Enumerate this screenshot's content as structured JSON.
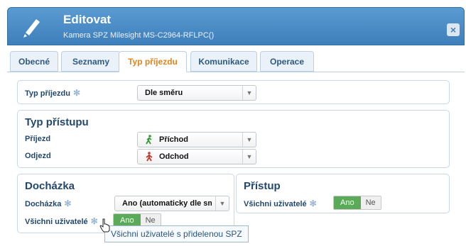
{
  "header": {
    "title": "Editovat",
    "subtitle": "Kamera SPZ Milesight MS-C2964-RFLPC()",
    "close_icon": "close-icon"
  },
  "tabs": [
    {
      "label": "Obecné",
      "active": false
    },
    {
      "label": "Seznamy",
      "active": false
    },
    {
      "label": "Typ příjezdu",
      "active": true
    },
    {
      "label": "Komunikace",
      "active": false
    },
    {
      "label": "Operace",
      "active": false
    }
  ],
  "typ_prijezdu": {
    "label": "Typ příjezdu",
    "value": "Dle směru"
  },
  "typ_pristupu": {
    "title": "Typ přístupu",
    "prijezd": {
      "label": "Příjezd",
      "value": "Příchod"
    },
    "odjezd": {
      "label": "Odjezd",
      "value": "Odchod"
    }
  },
  "dochazka": {
    "title": "Docházka",
    "field": {
      "label": "Docházka",
      "value": "Ano (automaticky dle směru)"
    },
    "vsichni": {
      "label": "Všichni uživatelé",
      "on": "Ano",
      "off": "Ne"
    }
  },
  "pristup": {
    "title": "Přístup",
    "vsichni": {
      "label": "Všichni uživatelé",
      "on": "Ano",
      "off": "Ne"
    }
  },
  "tooltip": "Všichni uživatelé s přidelenou SPZ",
  "colors": {
    "header": "#4a8cc7",
    "active_tab": "#e0841e",
    "toggle_on": "#5aaa5a",
    "walk_in": "#2e9e2e",
    "walk_out": "#c0392b"
  }
}
